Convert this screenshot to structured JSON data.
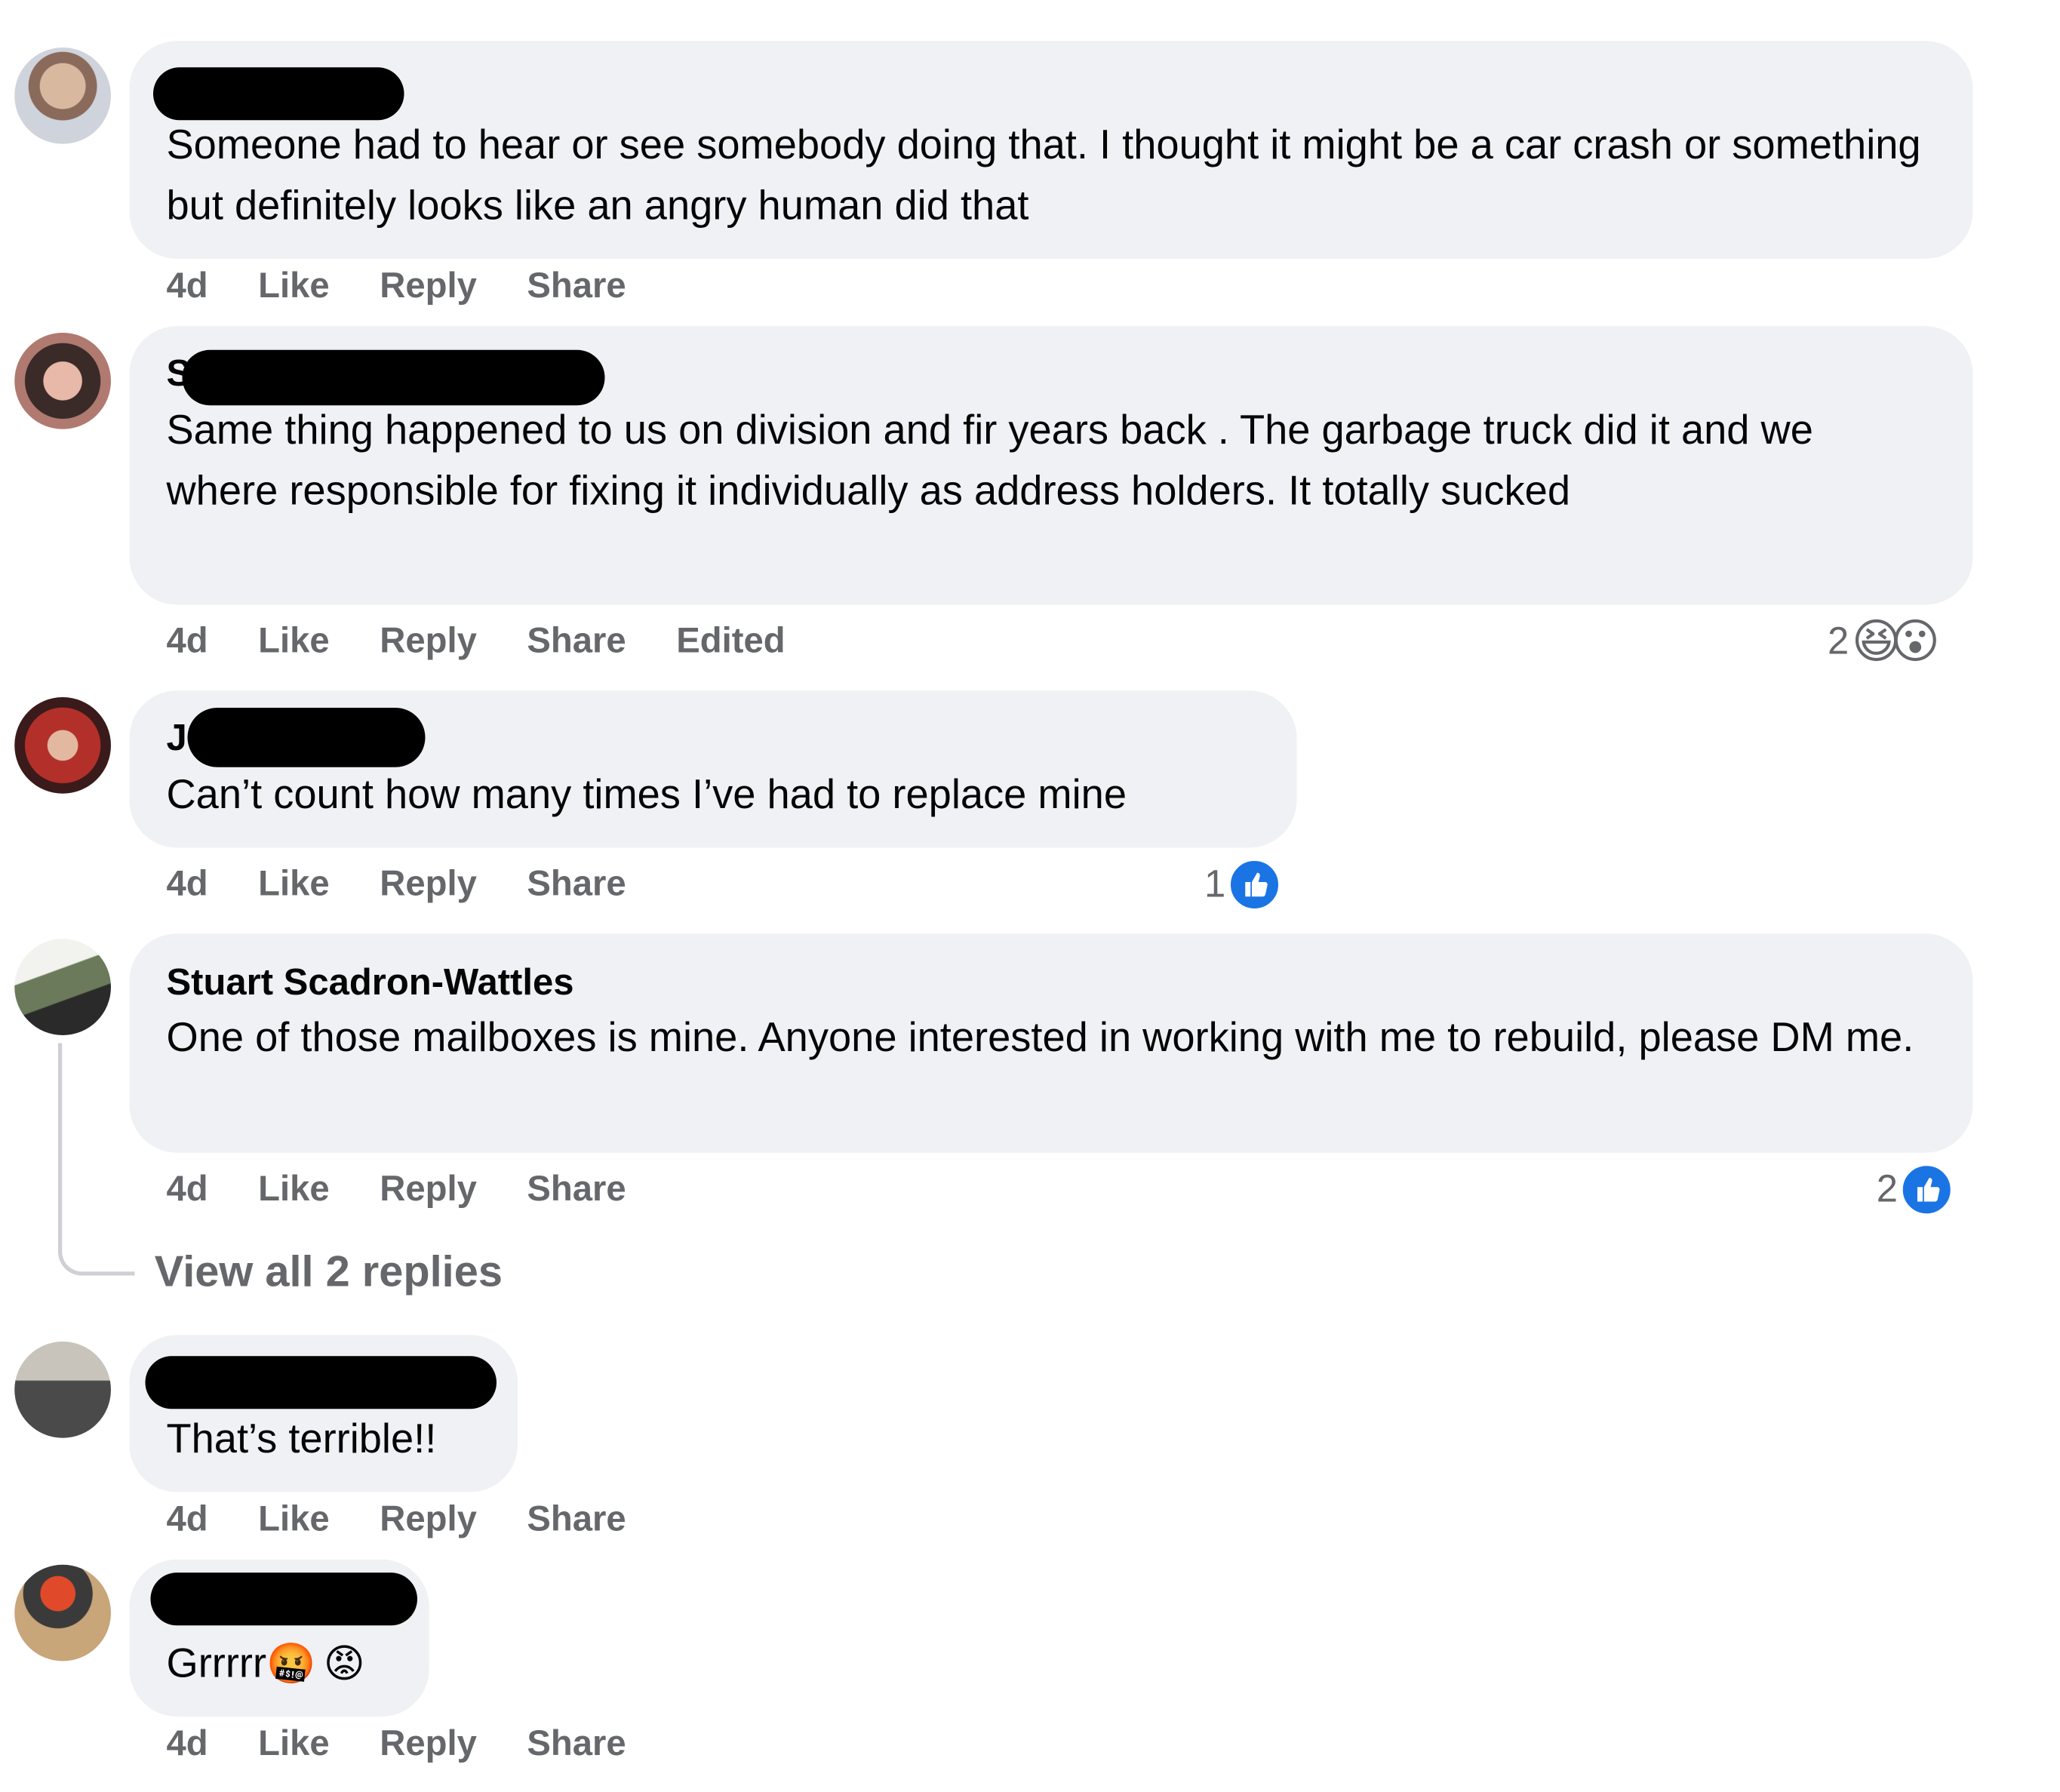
{
  "comments": [
    {
      "name": "",
      "text": "Someone had to hear or see somebody doing that. I thought it might be a car crash or something but definitely looks like an angry human did that",
      "time": "4d",
      "like": "Like",
      "reply": "Reply",
      "share": "Share"
    },
    {
      "name": "S",
      "text": "Same thing happened to us on division and fir years back . The garbage truck did it and we where responsible for fixing it individually as address holders. It totally sucked",
      "time": "4d",
      "like": "Like",
      "reply": "Reply",
      "share": "Share",
      "edited": "Edited",
      "reaction_count": "2",
      "reaction_icons": [
        "laughing-emoji-icon",
        "wow-emoji-icon"
      ]
    },
    {
      "name": "J",
      "text": "Can’t count how many times I’ve had to replace mine",
      "time": "4d",
      "like": "Like",
      "reply": "Reply",
      "share": "Share",
      "reaction_count": "1",
      "reaction_icons": [
        "like-reaction-icon"
      ]
    },
    {
      "name": "Stuart Scadron-Wattles",
      "text": "One of those mailboxes is mine. Anyone interested in working with me to rebuild, please DM me.",
      "time": "4d",
      "like": "Like",
      "reply": "Reply",
      "share": "Share",
      "reaction_count": "2",
      "reaction_icons": [
        "like-reaction-icon"
      ],
      "view_replies": "View all 2 replies"
    },
    {
      "name": "",
      "text": "That’s terrible!!",
      "time": "4d",
      "like": "Like",
      "reply": "Reply",
      "share": "Share"
    },
    {
      "name": "",
      "text": "Grrrrr",
      "text_emoji_icons": [
        "cursing-emoji-icon",
        "angry-emoji-icon"
      ],
      "time": "4d",
      "like": "Like",
      "reply": "Reply",
      "share": "Share"
    }
  ],
  "colors": {
    "bubble": "#eff1f4",
    "meta_text": "#65676b",
    "like_blue": "#1b74e4",
    "thread_line": "#ced0d4"
  }
}
